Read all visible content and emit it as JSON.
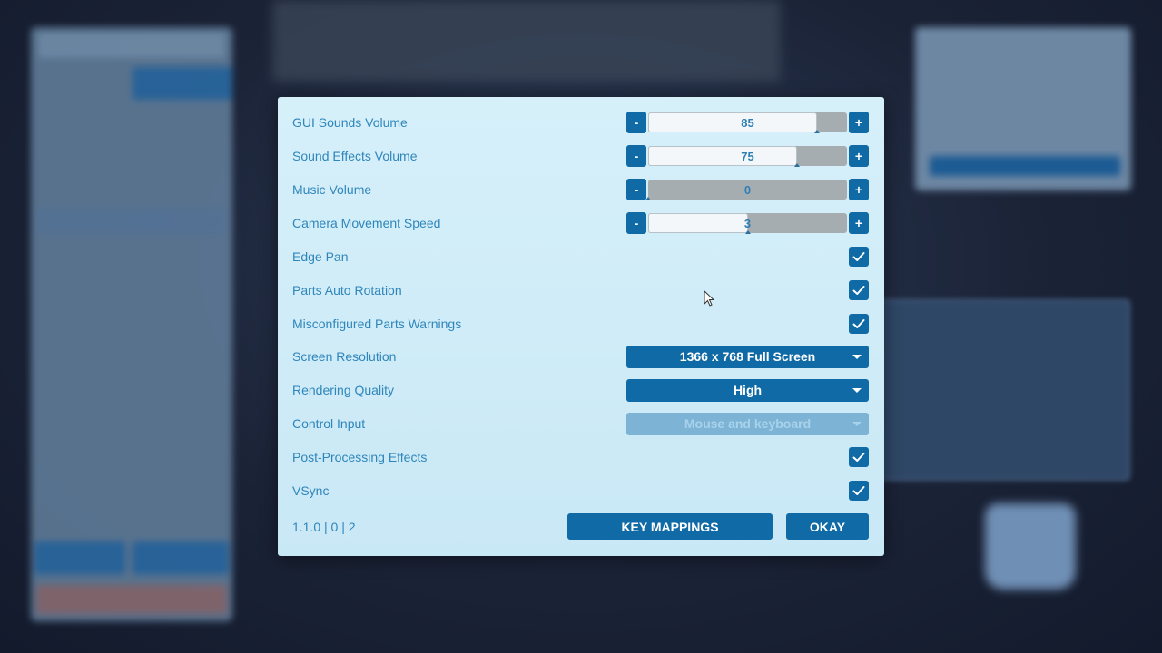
{
  "settings": {
    "gui_sounds_volume": {
      "label": "GUI Sounds Volume",
      "value": "85",
      "fraction": 0.85
    },
    "sound_effects_volume": {
      "label": "Sound Effects Volume",
      "value": "75",
      "fraction": 0.75
    },
    "music_volume": {
      "label": "Music Volume",
      "value": "0",
      "fraction": 0.0
    },
    "camera_movement_speed": {
      "label": "Camera Movement Speed",
      "value": "3",
      "fraction": 0.5
    },
    "edge_pan": {
      "label": "Edge Pan",
      "checked": true
    },
    "parts_auto_rotation": {
      "label": "Parts Auto Rotation",
      "checked": true
    },
    "misconfigured_parts_warnings": {
      "label": "Misconfigured Parts Warnings",
      "checked": true
    },
    "screen_resolution": {
      "label": "Screen Resolution",
      "value": "1366 x 768 Full Screen"
    },
    "rendering_quality": {
      "label": "Rendering Quality",
      "value": "High"
    },
    "control_input": {
      "label": "Control Input",
      "value": "Mouse and keyboard",
      "disabled": true
    },
    "post_processing_effects": {
      "label": "Post-Processing Effects",
      "checked": true
    },
    "vsync": {
      "label": "VSync",
      "checked": true
    }
  },
  "stepper": {
    "minus": "-",
    "plus": "+"
  },
  "footer": {
    "version": "1.1.0 | 0 | 2",
    "key_mappings_label": "KEY MAPPINGS",
    "okay_label": "OKAY"
  },
  "colors": {
    "accent": "#0f6aa6",
    "label": "#2f86bb",
    "dialog_bg": "#d6f0fa"
  }
}
